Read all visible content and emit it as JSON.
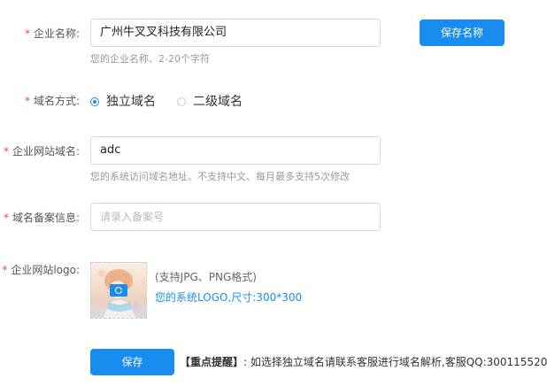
{
  "form": {
    "company_name": {
      "required_mark": "*",
      "label": "企业名称:",
      "value": "广州牛叉叉科技有限公司",
      "hint": "您的企业名称、2-20个字符",
      "save_button": "保存名称"
    },
    "domain_mode": {
      "required_mark": "*",
      "label": "域名方式:",
      "options": [
        {
          "label": "独立域名",
          "checked": true
        },
        {
          "label": "二级域名",
          "checked": false
        }
      ]
    },
    "site_domain": {
      "required_mark": "*",
      "label": "企业网站域名:",
      "value": "adc",
      "hint": "您的系统访问域名地址、不支持中文、每月最多支持5次修改"
    },
    "icp_info": {
      "required_mark": "*",
      "label": "域名备案信息:",
      "value": "",
      "placeholder": "请录入备案号"
    },
    "site_logo": {
      "required_mark": "*",
      "label": "企业网站logo:",
      "format_note": "(支持JPG、PNG格式)",
      "size_note": "您的系统LOGO,尺寸:300*300"
    },
    "save_button": "保存",
    "notice_title": "【重点提醒】",
    "notice_text": ": 如选择独立域名请联系客服进行域名解析,客服QQ:300115520"
  },
  "colors": {
    "accent": "#1a8cf0",
    "required": "#f0483e",
    "hint": "#999999",
    "logo_note": "#666666",
    "size_note": "#1a8cf0"
  }
}
